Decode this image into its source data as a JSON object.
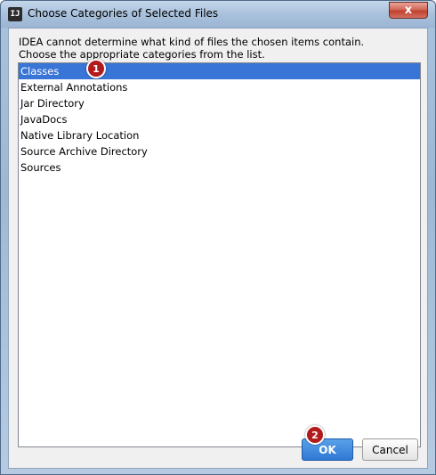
{
  "window": {
    "title": "Choose Categories of Selected Files",
    "app_icon_text": "IJ",
    "close_label": "x"
  },
  "dialog": {
    "description_line1": "IDEA cannot determine what kind of files the chosen items contain.",
    "description_line2": "Choose the appropriate categories from the list.",
    "categories": [
      {
        "label": "Classes",
        "selected": true
      },
      {
        "label": "External Annotations",
        "selected": false
      },
      {
        "label": "Jar Directory",
        "selected": false
      },
      {
        "label": "JavaDocs",
        "selected": false
      },
      {
        "label": "Native Library Location",
        "selected": false
      },
      {
        "label": "Source Archive Directory",
        "selected": false
      },
      {
        "label": "Sources",
        "selected": false
      }
    ],
    "ok_label": "OK",
    "cancel_label": "Cancel"
  },
  "annotations": {
    "badge1": "1",
    "badge2": "2"
  },
  "colors": {
    "selection": "#3875d7",
    "ok_button": "#2f79d4",
    "badge": "#b11b1b"
  }
}
